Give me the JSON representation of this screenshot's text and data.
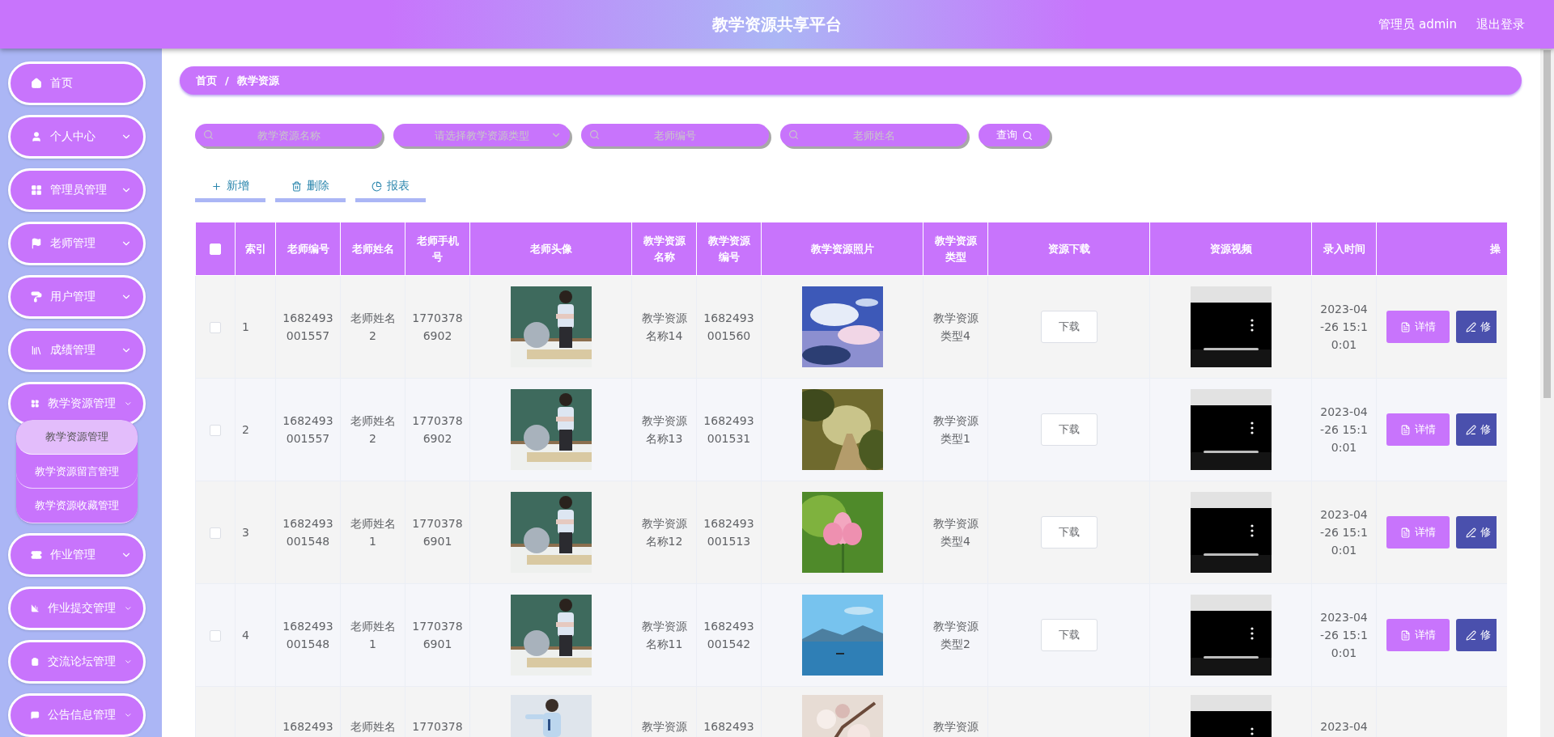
{
  "header": {
    "title": "教学资源共享平台",
    "user": "管理员 admin",
    "logout": "退出登录"
  },
  "sidebar": {
    "items": [
      {
        "label": "首页",
        "kind": "link"
      },
      {
        "label": "个人中心",
        "kind": "menu"
      },
      {
        "label": "管理员管理",
        "kind": "menu"
      },
      {
        "label": "老师管理",
        "kind": "menu"
      },
      {
        "label": "用户管理",
        "kind": "menu"
      },
      {
        "label": "成绩管理",
        "kind": "menu"
      },
      {
        "label": "教学资源管理",
        "kind": "menu",
        "children": [
          {
            "label": "教学资源管理",
            "selected": true
          },
          {
            "label": "教学资源留言管理",
            "selected": false
          },
          {
            "label": "教学资源收藏管理",
            "selected": false
          }
        ]
      },
      {
        "label": "作业管理",
        "kind": "menu"
      },
      {
        "label": "作业提交管理",
        "kind": "menu"
      },
      {
        "label": "交流论坛管理",
        "kind": "menu"
      },
      {
        "label": "公告信息管理",
        "kind": "menu"
      }
    ]
  },
  "breadcrumb": {
    "items": [
      "首页",
      "教学资源"
    ],
    "separator": "/"
  },
  "search": {
    "fields": [
      {
        "kind": "input",
        "placeholder": "教学资源名称"
      },
      {
        "kind": "select",
        "placeholder": "请选择教学资源类型"
      },
      {
        "kind": "input",
        "placeholder": "老师编号"
      },
      {
        "kind": "input",
        "placeholder": "老师姓名"
      }
    ],
    "button": "查询"
  },
  "actions": [
    {
      "kind": "add",
      "label": "新增"
    },
    {
      "kind": "delete",
      "label": "删除"
    },
    {
      "kind": "report",
      "label": "报表"
    }
  ],
  "table": {
    "all_checked": false,
    "columns": [
      "索引",
      "老师编号",
      "老师姓名",
      "老师手机号",
      "老师头像",
      "教学资源名称",
      "教学资源编号",
      "教学资源照片",
      "教学资源类型",
      "资源下载",
      "资源视频",
      "录入时间",
      "操"
    ],
    "rows": [
      {
        "kind": "full",
        "index": "1",
        "checked": false,
        "teacher_no": "1682493001557",
        "teacher_name": "老师姓名2",
        "phone": "17703786902",
        "resource_name": "教学资源名称14",
        "resource_no": "1682493001560",
        "resource_type": "教学资源类型4",
        "download": "下载",
        "entry_time": "2023-04-26 15:10:01",
        "detail": "详情",
        "edit": "修"
      },
      {
        "kind": "full",
        "index": "2",
        "checked": false,
        "teacher_no": "1682493001557",
        "teacher_name": "老师姓名2",
        "phone": "17703786902",
        "resource_name": "教学资源名称13",
        "resource_no": "1682493001531",
        "resource_type": "教学资源类型1",
        "download": "下载",
        "entry_time": "2023-04-26 15:10:01",
        "detail": "详情",
        "edit": "修"
      },
      {
        "kind": "full",
        "index": "3",
        "checked": false,
        "teacher_no": "1682493001548",
        "teacher_name": "老师姓名1",
        "phone": "17703786901",
        "resource_name": "教学资源名称12",
        "resource_no": "1682493001513",
        "resource_type": "教学资源类型4",
        "download": "下载",
        "entry_time": "2023-04-26 15:10:01",
        "detail": "详情",
        "edit": "修"
      },
      {
        "kind": "full",
        "index": "4",
        "checked": false,
        "teacher_no": "1682493001548",
        "teacher_name": "老师姓名1",
        "phone": "17703786901",
        "resource_name": "教学资源名称11",
        "resource_no": "1682493001542",
        "resource_type": "教学资源类型2",
        "download": "下载",
        "entry_time": "2023-04-26 15:10:01",
        "detail": "详情",
        "edit": "修"
      },
      {
        "kind": "partial",
        "teacher_no": "1682493",
        "teacher_name": "老师姓名",
        "phone": "1770378",
        "resource_name": "教学资源",
        "resource_no": "1682493",
        "resource_type": "教学资源",
        "entry_time": "2023-04"
      }
    ]
  }
}
